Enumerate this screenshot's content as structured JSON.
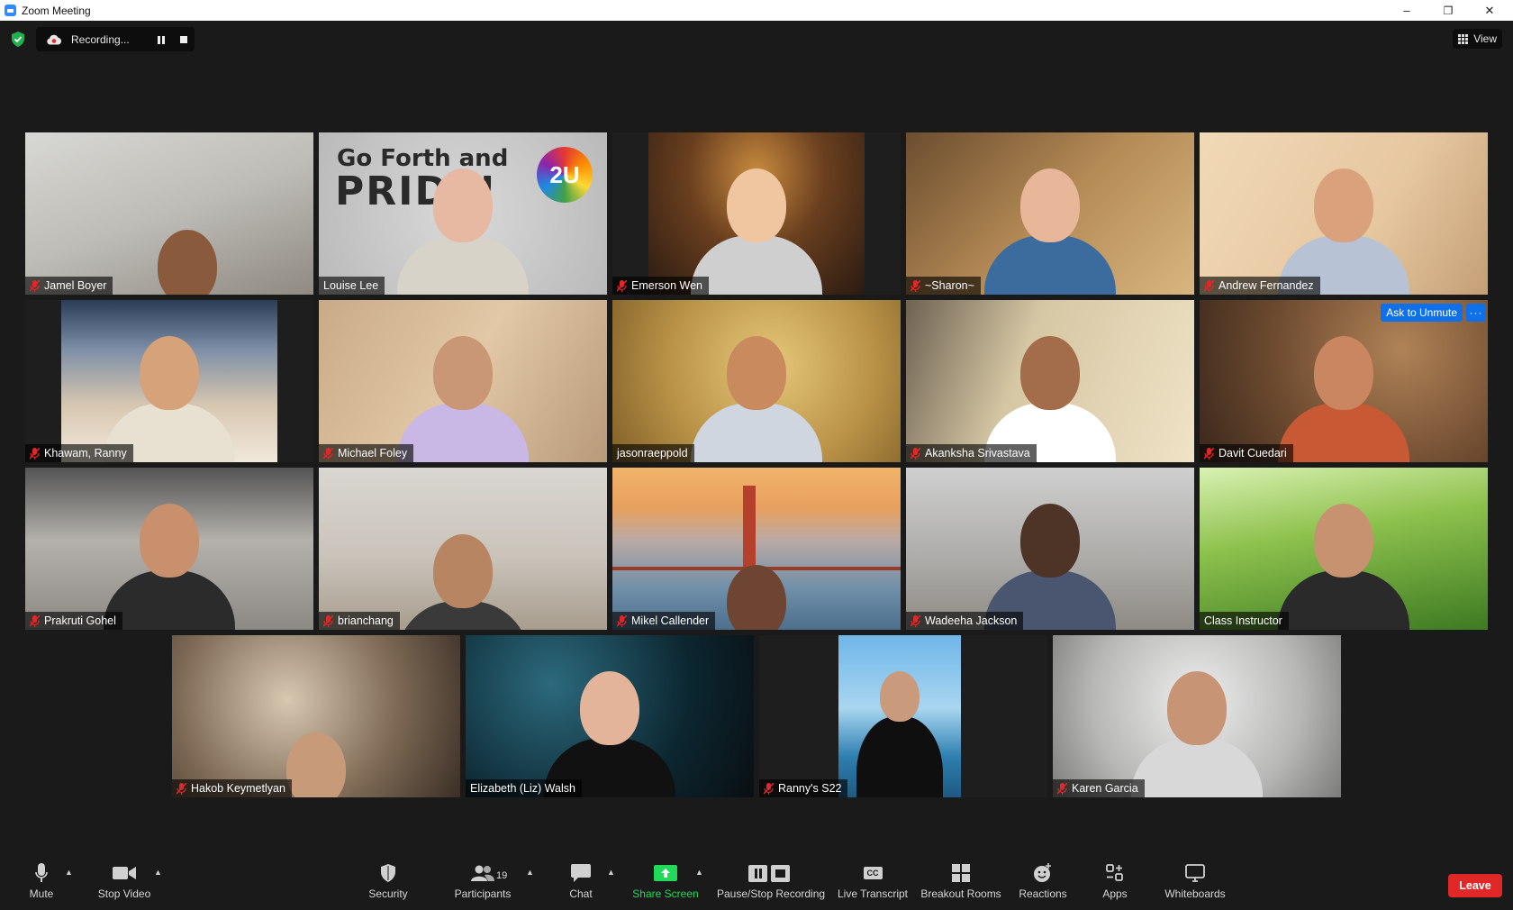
{
  "window": {
    "title": "Zoom Meeting",
    "minimize": "–",
    "restore": "❐",
    "close": "✕"
  },
  "recording": {
    "label": "Recording...",
    "pause_icon": "pause-icon",
    "stop_icon": "stop-icon"
  },
  "view_button": {
    "label": "View"
  },
  "participants": [
    {
      "name": "Jamel Boyer",
      "muted": true,
      "bg": "office-wall",
      "skin": "#8a5a3c"
    },
    {
      "name": "Louise Lee",
      "muted": false,
      "bg": "go-forth-and-pride",
      "skin": "#e7b9a3"
    },
    {
      "name": "Emerson Wen",
      "muted": true,
      "bg": "library",
      "skin": "#f0c6a0"
    },
    {
      "name": "~Sharon~",
      "muted": true,
      "bg": "warm-room",
      "skin": "#e8b79a"
    },
    {
      "name": "Andrew Fernandez",
      "muted": true,
      "bg": "bright-room",
      "skin": "#d9a27c"
    },
    {
      "name": "Khawam, Ranny",
      "muted": true,
      "bg": "penthouse",
      "skin": "#d5a27a"
    },
    {
      "name": "Michael Foley",
      "muted": true,
      "bg": "beige-room",
      "skin": "#c99776"
    },
    {
      "name": "jasonraeppold",
      "muted": false,
      "bg": "gold-room",
      "skin": "#c98a5e"
    },
    {
      "name": "Akanksha Srivastava",
      "muted": true,
      "bg": "sunlit-room",
      "skin": "#a36c4a"
    },
    {
      "name": "Davit Cuedari",
      "muted": true,
      "bg": "warm-lamp",
      "skin": "#c98660"
    },
    {
      "name": "Prakruti Gohel",
      "muted": true,
      "bg": "loft",
      "skin": "#c8906c"
    },
    {
      "name": "brianchang",
      "muted": true,
      "bg": "living-room",
      "skin": "#b88562"
    },
    {
      "name": "Mikel Callender",
      "muted": true,
      "bg": "golden-gate",
      "skin": "#6e4532"
    },
    {
      "name": "Wadeeha Jackson",
      "muted": true,
      "bg": "grey-room",
      "skin": "#4e3327"
    },
    {
      "name": "Class Instructor",
      "muted": false,
      "bg": "grass",
      "skin": "#c79270"
    },
    {
      "name": "Hakob Keymetlyan",
      "muted": true,
      "bg": "dim-room",
      "skin": "#c79a7a"
    },
    {
      "name": "Elizabeth (Liz) Walsh",
      "muted": false,
      "bg": "dark-teal",
      "skin": "#e4b49a",
      "active_speaker": true
    },
    {
      "name": "Ranny's S22",
      "muted": true,
      "bg": "beach",
      "skin": "#c99a7c"
    },
    {
      "name": "Karen Garcia",
      "muted": true,
      "bg": "soft-grey",
      "skin": "#c89476"
    }
  ],
  "tile_actions": {
    "ask_to_unmute": "Ask to Unmute",
    "more": "···"
  },
  "toolbar": {
    "mute": "Mute",
    "stop_video": "Stop Video",
    "security": "Security",
    "participants": "Participants",
    "participants_count": "19",
    "chat": "Chat",
    "share_screen": "Share Screen",
    "pause_stop_recording": "Pause/Stop Recording",
    "live_transcript": "Live Transcript",
    "live_transcript_icon_text": "CC",
    "breakout_rooms": "Breakout Rooms",
    "reactions": "Reactions",
    "apps": "Apps",
    "whiteboards": "Whiteboards",
    "leave": "Leave"
  },
  "colors": {
    "accent_blue": "#0e71eb",
    "leave_red": "#e02828",
    "share_green": "#23d959",
    "active_speaker": "#f0e77a",
    "mute_red": "#e02828"
  },
  "banner_text": {
    "line1": "Go Forth and",
    "line2": "PRIDE!",
    "badge": "2U"
  }
}
